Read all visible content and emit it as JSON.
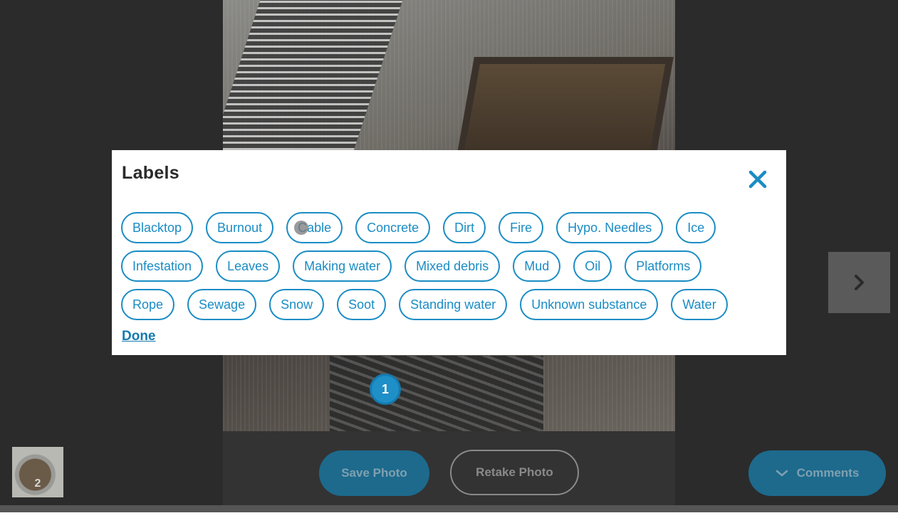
{
  "modal": {
    "title": "Labels",
    "close_icon": "close-icon",
    "labels_row1": [
      "Blacktop",
      "Burnout",
      "Cable",
      "Concrete",
      "Dirt",
      "Fire",
      "Hypo. Needles",
      "Ice"
    ],
    "labels_row2": [
      "Infestation",
      "Leaves",
      "Making water",
      "Mixed debris",
      "Mud",
      "Oil",
      "Platforms"
    ],
    "labels_row3": [
      "Rope",
      "Sewage",
      "Snow",
      "Soot",
      "Standing water",
      "Unknown substance",
      "Water"
    ],
    "done_label": "Done"
  },
  "photo": {
    "pin_number": "1"
  },
  "thumbnail": {
    "count": "2"
  },
  "actions": {
    "save_label": "Save Photo",
    "retake_label": "Retake Photo",
    "comments_label": "Comments",
    "comments_icon": "chevron-down-icon",
    "next_icon": "chevron-right-icon"
  },
  "colors": {
    "accent": "#1a8cc4",
    "background": "#2b2b2b",
    "modal": "#ffffff"
  }
}
